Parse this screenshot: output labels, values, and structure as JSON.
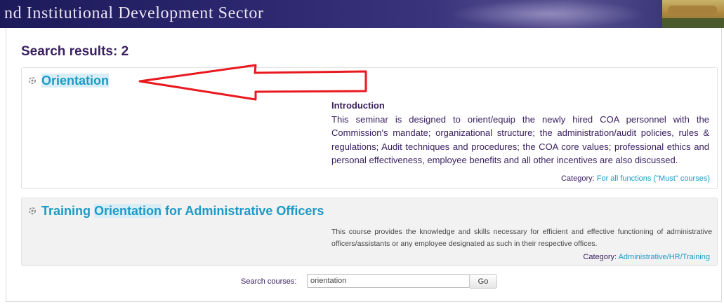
{
  "banner": {
    "title": "nd Institutional Development Sector"
  },
  "results": {
    "heading": "Search results: 2"
  },
  "courses": [
    {
      "title_prefix": "",
      "title_highlight": "Orientation",
      "title_suffix": "",
      "summary_heading": "Introduction",
      "summary_text": "This seminar is designed to orient/equip the newly hired COA personnel with the Commission's mandate; organizational structure; the administration/audit policies, rules & regulations; Audit techniques and procedures; the COA core values; professional ethics and personal effectiveness, employee benefits and all other incentives are also discussed.",
      "category_label": "Category:",
      "category_link": "For all functions (\"Must\" courses)"
    },
    {
      "title_prefix": "Training ",
      "title_highlight": "Orientation",
      "title_suffix": " for Administrative Officers",
      "summary_text": "This course provides the knowledge and skills necessary for efficient and effective functioning of administrative officers/assistants or any employee designated as such in their respective offices.",
      "category_label": "Category:",
      "category_link": "Administrative/HR/Training"
    }
  ],
  "search": {
    "label": "Search courses:",
    "value": "orientation",
    "go_label": "Go"
  },
  "colors": {
    "heading": "#3a2060",
    "link": "#1b9ac5",
    "annotation_arrow": "#e8191f"
  },
  "icons": {
    "course": "course-icon"
  }
}
